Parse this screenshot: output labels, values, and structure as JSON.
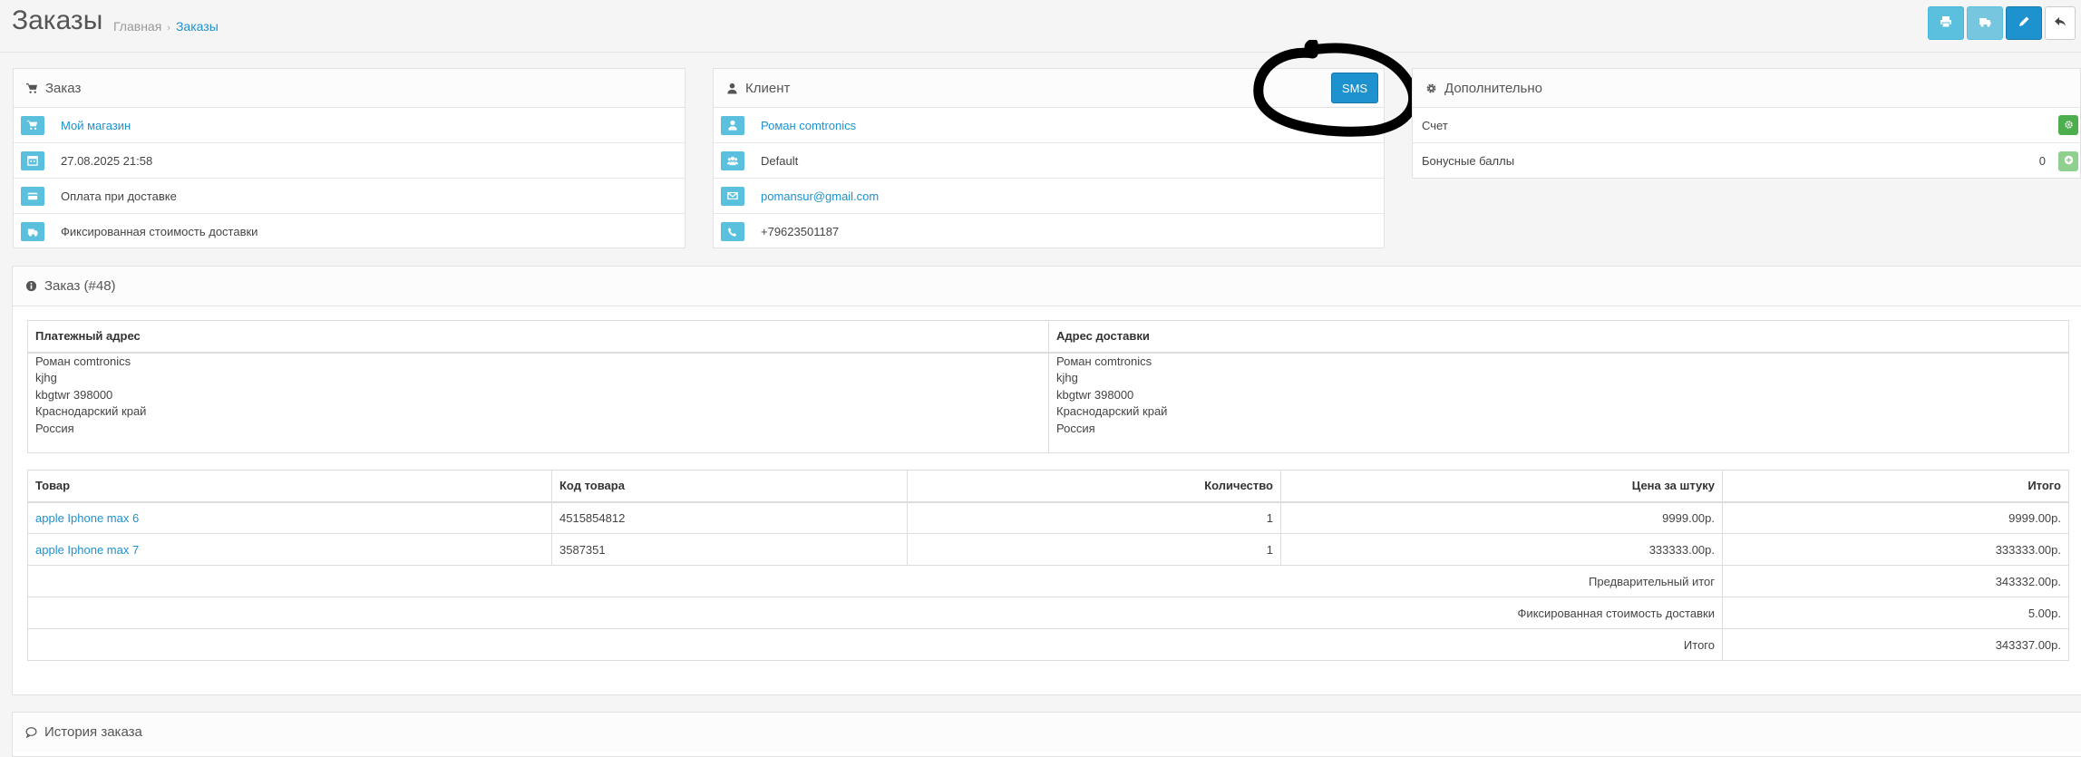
{
  "header": {
    "title": "Заказы",
    "breadcrumb": [
      "Главная",
      "Заказы"
    ],
    "buttons": [
      {
        "name": "print-invoice-button",
        "icon": "print-icon",
        "style": "info"
      },
      {
        "name": "print-shipping-button",
        "icon": "truck-icon",
        "style": "info2"
      },
      {
        "name": "edit-button",
        "icon": "pencil-icon",
        "style": "primary"
      },
      {
        "name": "back-button",
        "icon": "reply-icon",
        "style": "default"
      }
    ]
  },
  "order_panel": {
    "title": "Заказ",
    "store": "Мой магазин",
    "date": "27.08.2025 21:58",
    "payment": "Оплата при доставке",
    "shipping": "Фиксированная стоимость доставки"
  },
  "customer_panel": {
    "title": "Клиент",
    "name": "Роман comtronics",
    "group": "Default",
    "email": "pomansur@gmail.com",
    "phone": "+79623501187",
    "sms_label": "SMS"
  },
  "extra_panel": {
    "title": "Дополнительно",
    "invoice_label": "Счет",
    "bonus_label": "Бонусные баллы",
    "bonus_value": "0"
  },
  "order_details": {
    "title": "Заказ (#48)",
    "payment_address_header": "Платежный адрес",
    "shipping_address_header": "Адрес доставки",
    "payment_address": [
      "Роман comtronics",
      "kjhg",
      "kbgtwr 398000",
      "Краснодарский край",
      "Россия"
    ],
    "shipping_address": [
      "Роман comtronics",
      "kjhg",
      "kbgtwr 398000",
      "Краснодарский край",
      "Россия"
    ],
    "columns": [
      "Товар",
      "Код товара",
      "Количество",
      "Цена за штуку",
      "Итого"
    ],
    "products": [
      {
        "name": "apple Iphone max 6",
        "code": "4515854812",
        "qty": "1",
        "price": "9999.00р.",
        "total": "9999.00р."
      },
      {
        "name": "apple Iphone max 7",
        "code": "3587351",
        "qty": "1",
        "price": "333333.00р.",
        "total": "333333.00р."
      }
    ],
    "totals": [
      {
        "label": "Предварительный итог",
        "value": "343332.00р."
      },
      {
        "label": "Фиксированная стоимость доставки",
        "value": "5.00р."
      },
      {
        "label": "Итого",
        "value": "343337.00р."
      }
    ]
  },
  "history": {
    "title": "История заказа"
  },
  "colors": {
    "primary": "#1e91cf",
    "info": "#5bc0de",
    "success": "#4cae4c",
    "annotation": "#000000"
  }
}
